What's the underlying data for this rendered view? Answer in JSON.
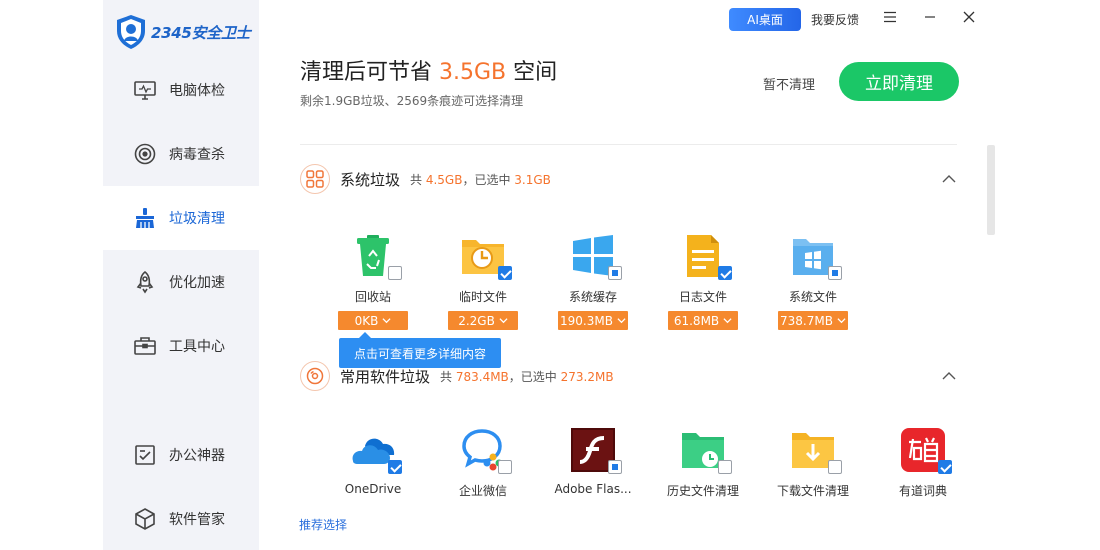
{
  "app": {
    "logo_text": "2345安全卫士"
  },
  "sidebar": {
    "items": [
      {
        "label": "电脑体检",
        "icon": "monitor-icon"
      },
      {
        "label": "病毒查杀",
        "icon": "target-icon"
      },
      {
        "label": "垃圾清理",
        "icon": "broom-icon",
        "active": true
      },
      {
        "label": "优化加速",
        "icon": "rocket-icon"
      },
      {
        "label": "工具中心",
        "icon": "toolbox-icon"
      },
      {
        "label": "办公神器",
        "icon": "document-check-icon"
      },
      {
        "label": "软件管家",
        "icon": "cube-icon"
      }
    ]
  },
  "topbar": {
    "ai_label": "AI桌面",
    "feedback_label": "我要反馈"
  },
  "header": {
    "title_prefix": "清理后可节省 ",
    "title_value": "3.5GB",
    "title_suffix": " 空间",
    "subtitle": "剩余1.9GB垃圾、2569条痕迹可选择清理",
    "skip_label": "暂不清理",
    "clean_label": "立即清理"
  },
  "sections": [
    {
      "title": "系统垃圾",
      "meta_prefix": "共 ",
      "total": "4.5GB",
      "meta_mid": "，已选中 ",
      "selected": "3.1GB",
      "items": [
        {
          "name": "回收站",
          "size": "0KB",
          "icon": "recycle-bin-icon",
          "check": "off"
        },
        {
          "name": "临时文件",
          "size": "2.2GB",
          "icon": "temp-folder-icon",
          "check": "on"
        },
        {
          "name": "系统缓存",
          "size": "190.3MB",
          "icon": "windows-icon",
          "check": "part"
        },
        {
          "name": "日志文件",
          "size": "61.8MB",
          "icon": "log-file-icon",
          "check": "on"
        },
        {
          "name": "系统文件",
          "size": "738.7MB",
          "icon": "system-file-icon",
          "check": "part"
        }
      ]
    },
    {
      "title": "常用软件垃圾",
      "meta_prefix": "共 ",
      "total": "783.4MB",
      "meta_mid": "，已选中 ",
      "selected": "273.2MB",
      "items": [
        {
          "name": "OneDrive",
          "icon": "onedrive-icon",
          "check": "on"
        },
        {
          "name": "企业微信",
          "icon": "wecom-icon",
          "check": "off"
        },
        {
          "name": "Adobe Flas...",
          "icon": "flash-icon",
          "check": "part"
        },
        {
          "name": "历史文件清理",
          "icon": "history-folder-icon",
          "check": "off"
        },
        {
          "name": "下载文件清理",
          "icon": "download-folder-icon",
          "check": "off"
        },
        {
          "name": "有道词典",
          "icon": "youdao-icon",
          "check": "on"
        }
      ]
    }
  ],
  "tooltip": "点击可查看更多详细内容",
  "recommend_label": "推荐选择",
  "colors": {
    "accent": "#f5732d",
    "primary": "#1bc767",
    "link": "#2a6fdc",
    "tag": "#f5892e"
  }
}
